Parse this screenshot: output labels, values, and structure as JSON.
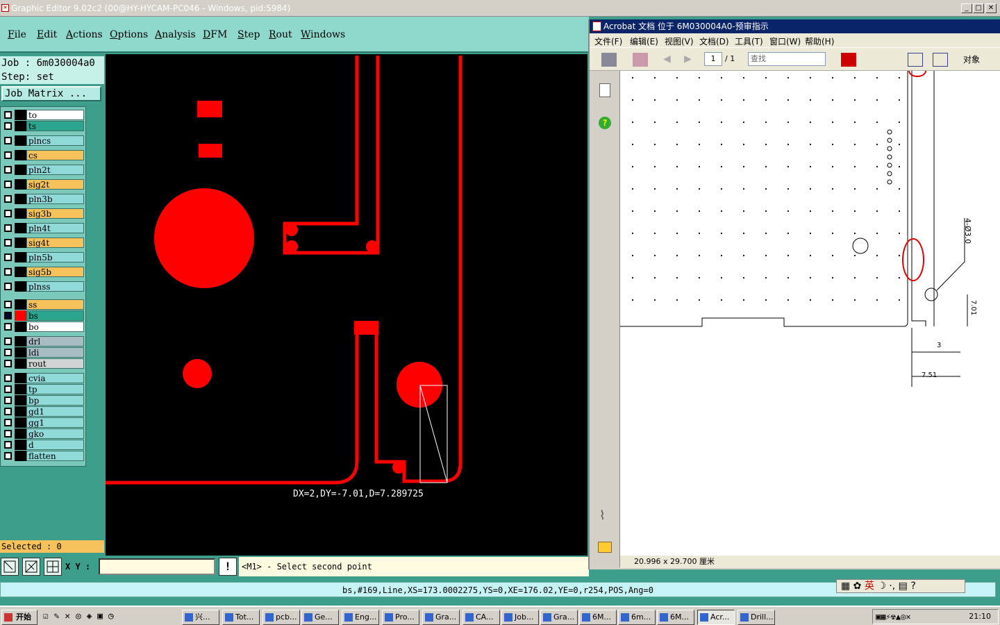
{
  "window": {
    "title": "Graphic Editor 9.02c2 (00@HY-HYCAM-PC046 - Windows, pid:5984)"
  },
  "menu": [
    "File",
    "Edit",
    "Actions",
    "Options",
    "Analysis",
    "DFM",
    "Step",
    "Rout",
    "Windows"
  ],
  "job": {
    "job_label": "Job : 6m030004a0",
    "step_label": "Step: set",
    "matrix_button": "Job Matrix ..."
  },
  "layers": [
    {
      "name": "to",
      "color": "#ffffff"
    },
    {
      "name": "ts",
      "color": "#2ba58d"
    },
    {
      "name": "plncs",
      "color": "#8fd9d9"
    },
    {
      "name": "cs",
      "color": "#f7c15b"
    },
    {
      "name": "pln2t",
      "color": "#8fd9d9"
    },
    {
      "name": "sig2t",
      "color": "#f7c15b"
    },
    {
      "name": "pln3b",
      "color": "#8fd9d9"
    },
    {
      "name": "sig3b",
      "color": "#f7c15b"
    },
    {
      "name": "pln4t",
      "color": "#8fd9d9"
    },
    {
      "name": "sig4t",
      "color": "#f7c15b"
    },
    {
      "name": "pln5b",
      "color": "#8fd9d9"
    },
    {
      "name": "sig5b",
      "color": "#f7c15b"
    },
    {
      "name": "plnss",
      "color": "#8fd9d9"
    },
    {
      "name": "ss",
      "color": "#f7c15b"
    },
    {
      "name": "bs",
      "color": "#2ba58d",
      "active": true
    },
    {
      "name": "bo",
      "color": "#ffffff"
    },
    {
      "name": "drl",
      "color": "#a8bcc4"
    },
    {
      "name": "ldi",
      "color": "#a8bcc4"
    },
    {
      "name": "rout",
      "color": "#d0d4d4"
    },
    {
      "name": "cvia",
      "color": "#8fd9d9"
    },
    {
      "name": "tp",
      "color": "#8fd9d9"
    },
    {
      "name": "bp",
      "color": "#8fd9d9"
    },
    {
      "name": "gd1",
      "color": "#8fd9d9"
    },
    {
      "name": "gg1",
      "color": "#8fd9d9"
    },
    {
      "name": "gko",
      "color": "#8fd9d9"
    },
    {
      "name": "d",
      "color": "#8fd9d9"
    },
    {
      "name": "flatten",
      "color": "#8fd9d9"
    }
  ],
  "selected": "Selected : 0",
  "measure": "DX=2,DY=-7.01,D=7.289725",
  "xy_label": "X Y :",
  "xy_value": "",
  "prompt": "<M1> - Select second point",
  "status": "bs,#169,Line,XS=173.0002275,YS=0,XE=176.02,YE=0,r254,POS,Ang=0",
  "acrobat": {
    "title": "Acrobat 文档 位于 6M030004A0-预审指示",
    "menu": [
      "文件(F)",
      "编辑(E)",
      "视图(V)",
      "文档(D)",
      "工具(T)",
      "窗口(W)",
      "帮助(H)"
    ],
    "page": "1",
    "page_total": "/ 1",
    "search_placeholder": "查找",
    "extra_button": "对象",
    "page_size": "20.996 x 29.700 厘米",
    "dims": {
      "holes": "4-Ø3.0",
      "d1": "7.01",
      "d2": "3",
      "d3": "7.51"
    }
  },
  "taskbar": {
    "start": "开始",
    "tasks": [
      "兴...",
      "Tot...",
      "pcb...",
      "Ge...",
      "Eng...",
      "Pro...",
      "Gra...",
      "CA...",
      "Job...",
      "Gra...",
      "6M...",
      "6m...",
      "6M...",
      "Acr...",
      "Drill..."
    ],
    "clock": "21:10",
    "ime": "英"
  }
}
